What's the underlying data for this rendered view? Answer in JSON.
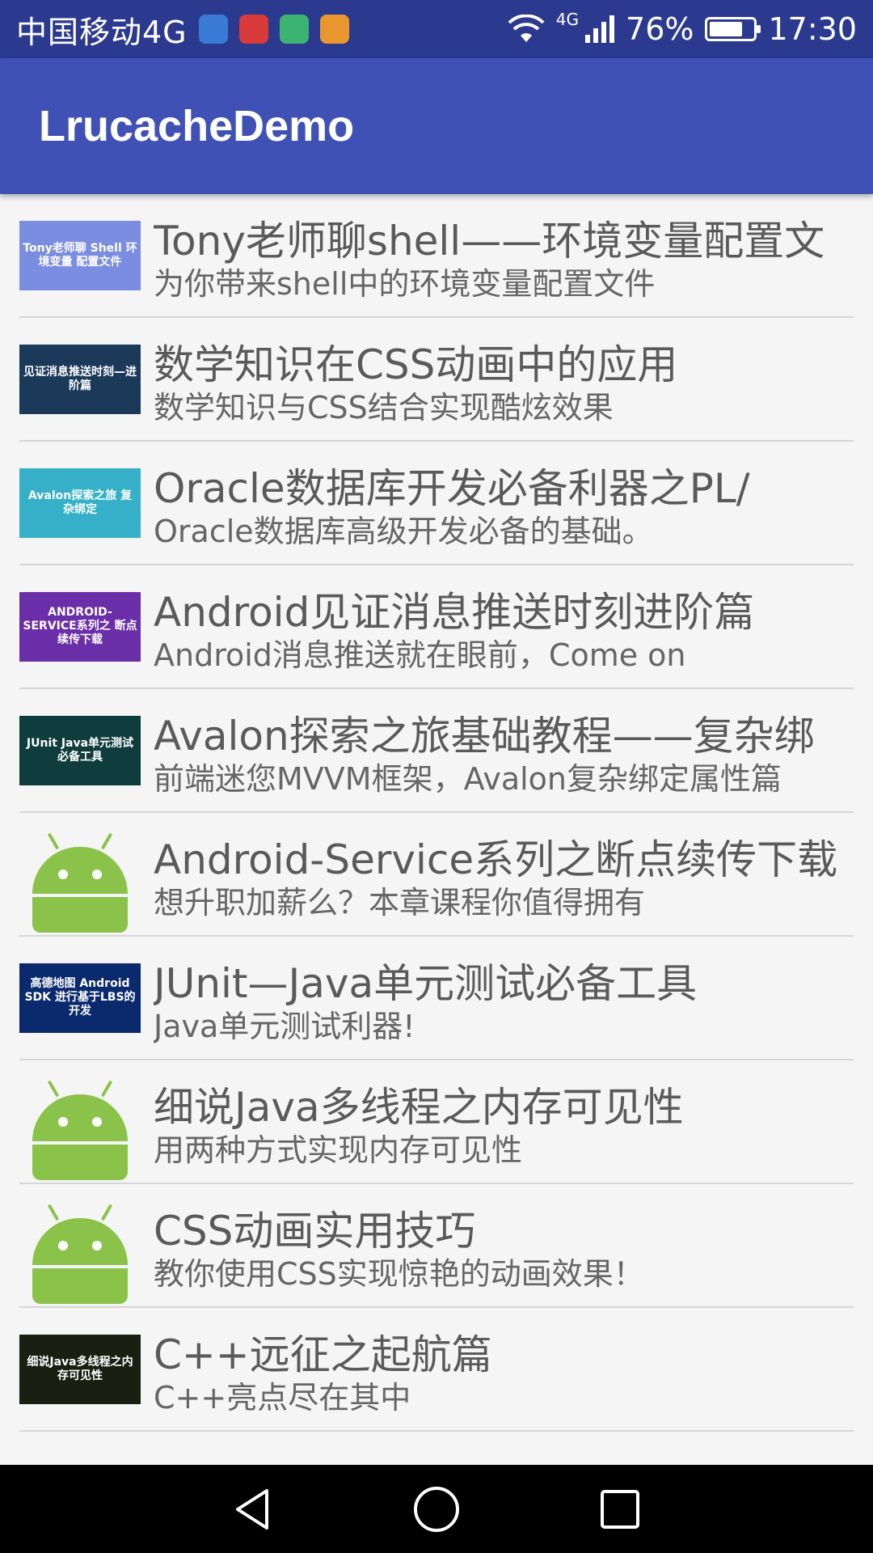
{
  "status_bar": {
    "carrier": "中国移动4G",
    "network": "4G",
    "battery_percent": "76%",
    "battery_level": 0.76,
    "time": "17:30"
  },
  "app_bar": {
    "title": "LrucacheDemo"
  },
  "items": [
    {
      "title": "Tony老师聊shell——环境变量配置文",
      "subtitle": "为你带来shell中的环境变量配置文件",
      "thumb": "image",
      "thumb_text": "Tony老师聊 Shell 环境变量 配置文件",
      "color": "#7b8de0"
    },
    {
      "title": "数学知识在CSS动画中的应用",
      "subtitle": "数学知识与CSS结合实现酷炫效果",
      "thumb": "image",
      "thumb_text": "见证消息推送时刻—进阶篇",
      "color": "#1b3a5a"
    },
    {
      "title": "Oracle数据库开发必备利器之PL/",
      "subtitle": "Oracle数据库高级开发必备的基础。",
      "thumb": "image",
      "thumb_text": "Avalon探索之旅 复杂绑定",
      "color": "#35b0c8"
    },
    {
      "title": "Android见证消息推送时刻进阶篇",
      "subtitle": "Android消息推送就在眼前，Come on",
      "thumb": "image",
      "thumb_text": "ANDROID-SERVICE系列之 断点续传下载",
      "color": "#6a2ea8"
    },
    {
      "title": "Avalon探索之旅基础教程——复杂绑",
      "subtitle": "前端迷您MVVM框架，Avalon复杂绑定属性篇",
      "thumb": "image",
      "thumb_text": "JUnit Java单元测试必备工具",
      "color": "#0f3c3c"
    },
    {
      "title": "Android-Service系列之断点续传下载",
      "subtitle": "想升职加薪么？本章课程你值得拥有",
      "thumb": "robot"
    },
    {
      "title": "JUnit—Java单元测试必备工具",
      "subtitle": "Java单元测试利器!",
      "thumb": "image",
      "thumb_text": "高德地图 Android SDK 进行基于LBS的开发",
      "color": "#0b2a6e"
    },
    {
      "title": "细说Java多线程之内存可见性",
      "subtitle": "用两种方式实现内存可见性",
      "thumb": "robot"
    },
    {
      "title": "CSS动画实用技巧",
      "subtitle": "教你使用CSS实现惊艳的动画效果！",
      "thumb": "robot"
    },
    {
      "title": "C++远征之起航篇",
      "subtitle": "C++亮点尽在其中",
      "thumb": "image",
      "thumb_text": "细说Java多线程之内存可见性",
      "color": "#1a1f12"
    }
  ],
  "icons": {
    "notif_1": "#3a7bd5",
    "notif_2": "#d93a3a",
    "notif_3": "#3cb371",
    "notif_4": "#e8962e"
  }
}
